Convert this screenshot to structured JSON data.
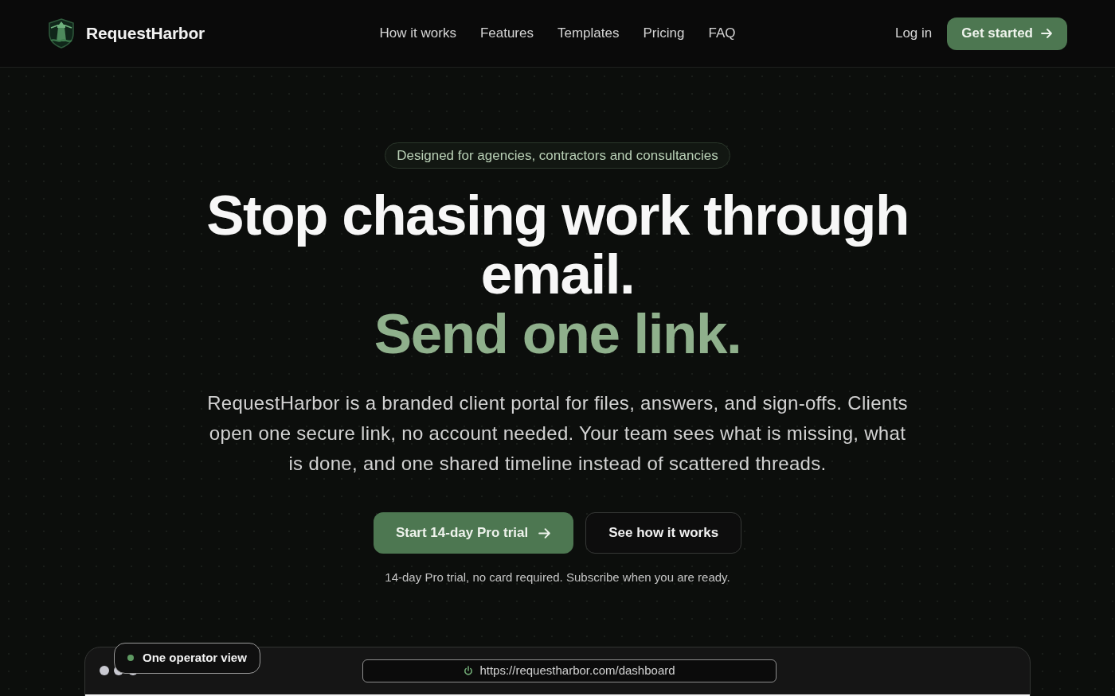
{
  "brand": {
    "name": "RequestHarbor"
  },
  "nav": {
    "links": [
      {
        "label": "How it works"
      },
      {
        "label": "Features"
      },
      {
        "label": "Templates"
      },
      {
        "label": "Pricing"
      },
      {
        "label": "FAQ"
      }
    ],
    "login": "Log in",
    "cta": "Get started"
  },
  "hero": {
    "badge": "Designed for agencies, contractors and consultancies",
    "headline": "Stop chasing work through email.",
    "headline_accent": "Send one link.",
    "description": "RequestHarbor is a branded client portal for files, answers, and sign-offs. Clients open one secure link, no account needed. Your team sees what is missing, what is done, and one shared timeline instead of scattered threads.",
    "primary_button": "Start 14-day Pro trial",
    "secondary_button": "See how it works",
    "note": "14-day Pro trial, no card required. Subscribe when you are ready."
  },
  "preview": {
    "tag": "One operator view",
    "url": "https://requestharbor.com/dashboard"
  }
}
